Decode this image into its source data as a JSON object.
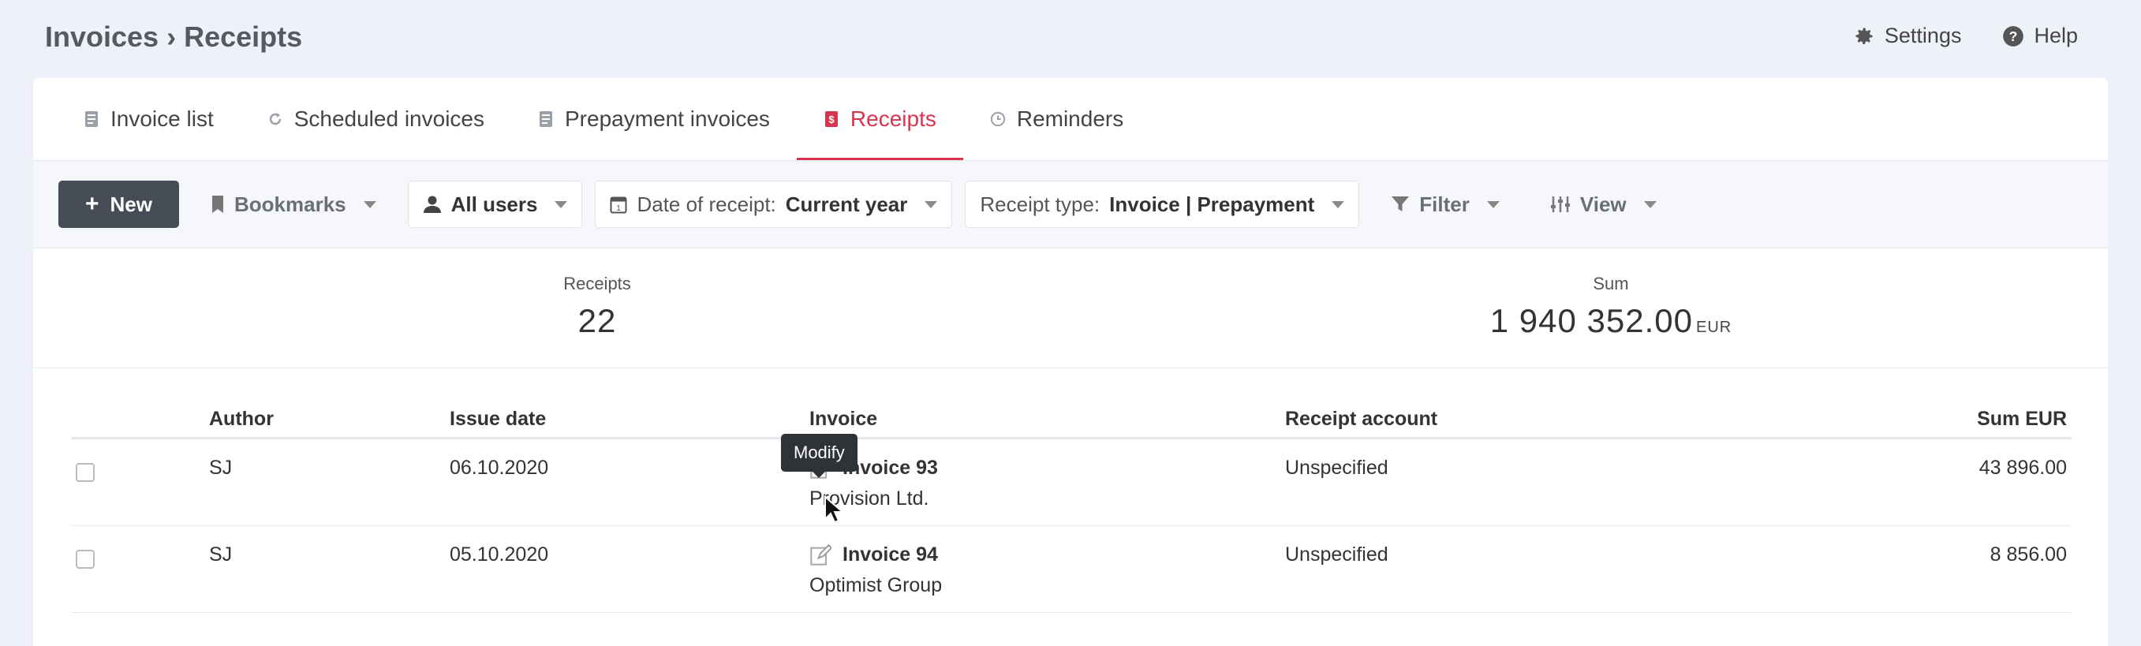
{
  "header": {
    "breadcrumb_parent": "Invoices",
    "breadcrumb_separator": "›",
    "breadcrumb_current": "Receipts",
    "settings_label": "Settings",
    "help_label": "Help"
  },
  "tabs": [
    {
      "label": "Invoice list",
      "icon": "document-icon"
    },
    {
      "label": "Scheduled invoices",
      "icon": "refresh-icon"
    },
    {
      "label": "Prepayment invoices",
      "icon": "document-icon"
    },
    {
      "label": "Receipts",
      "icon": "receipt-dollar-icon",
      "active": true
    },
    {
      "label": "Reminders",
      "icon": "clock-icon"
    }
  ],
  "toolbar": {
    "new_label": "New",
    "bookmarks_label": "Bookmarks",
    "users_label": "All users",
    "date_prefix": "Date of receipt:",
    "date_value": "Current year",
    "type_prefix": "Receipt type:",
    "type_value": "Invoice | Prepayment",
    "filter_label": "Filter",
    "view_label": "View"
  },
  "summary": {
    "receipts_label": "Receipts",
    "receipts_value": "22",
    "sum_label": "Sum",
    "sum_value": "1 940 352.00",
    "sum_unit": "EUR"
  },
  "table": {
    "columns": {
      "author": "Author",
      "issue_date": "Issue date",
      "invoice": "Invoice",
      "receipt_account": "Receipt account",
      "sum": "Sum EUR"
    },
    "rows": [
      {
        "author": "SJ",
        "issue_date": "06.10.2020",
        "invoice": "Invoice 93",
        "client": "Provision Ltd.",
        "account": "Unspecified",
        "sum": "43 896.00"
      },
      {
        "author": "SJ",
        "issue_date": "05.10.2020",
        "invoice": "Invoice 94",
        "client": "Optimist Group",
        "account": "Unspecified",
        "sum": "8 856.00"
      }
    ]
  },
  "tooltip": {
    "text": "Modify"
  },
  "colors": {
    "accent": "#d7354e",
    "primary_button": "#474d56",
    "background": "#eef2f8"
  }
}
